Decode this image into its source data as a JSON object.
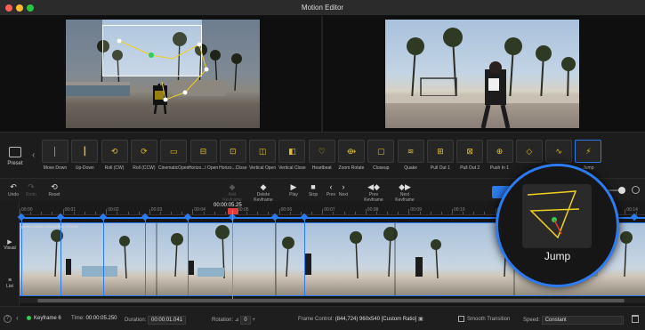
{
  "window": {
    "title": "Motion Editor"
  },
  "preset": {
    "tab_label": "Preset",
    "items": [
      {
        "name": "Move Down",
        "icon": "move-down-icon"
      },
      {
        "name": "Up-Down",
        "icon": "up-down-icon"
      },
      {
        "name": "Roll (CW)",
        "icon": "roll-cw-icon"
      },
      {
        "name": "Roll (CCW)",
        "icon": "roll-ccw-icon"
      },
      {
        "name": "CinematicOpen",
        "icon": "cinematic-open-icon"
      },
      {
        "name": "Horizo...l Open",
        "icon": "horizontal-open-icon"
      },
      {
        "name": "Horizo...Close",
        "icon": "horizontal-close-icon"
      },
      {
        "name": "Vertical Open",
        "icon": "vertical-open-icon"
      },
      {
        "name": "Vertical Close",
        "icon": "vertical-close-icon"
      },
      {
        "name": "Heartbeat",
        "icon": "heartbeat-icon"
      },
      {
        "name": "Zoom Rotate",
        "icon": "zoom-rotate-icon"
      },
      {
        "name": "Closeup",
        "icon": "closeup-icon"
      },
      {
        "name": "Quake",
        "icon": "quake-icon"
      },
      {
        "name": "Pull Out 1",
        "icon": "pull-out-1-icon"
      },
      {
        "name": "Pull Out 2",
        "icon": "pull-out-2-icon"
      },
      {
        "name": "Push In 1",
        "icon": "push-in-1-icon"
      },
      {
        "name": "",
        "icon": "preset-icon"
      },
      {
        "name": "Earthquake",
        "icon": "earthquake-icon"
      },
      {
        "name": "Jump",
        "icon": "jump-icon"
      }
    ],
    "selected": "Jump"
  },
  "toolbar": {
    "undo": "Undo",
    "redo": "Redo",
    "reset": "Reset",
    "add_keyframe": "Add Keyframe",
    "delete_keyframe": "Delete Keyframe",
    "play": "Play",
    "stop": "Stop",
    "prev": "Prev",
    "next": "Next",
    "prev_keyframe": "Prev Keyframe",
    "next_keyframe": "Next Keyframe"
  },
  "timeline": {
    "playhead_time": "00:00:05.25",
    "ruler_labels": [
      "00:00",
      "00:01",
      "00:02",
      "00:03",
      "00:04",
      "00:05",
      "00:06",
      "00:07",
      "00:08",
      "00:09",
      "00:10",
      "00:11",
      "00:12",
      "00:13",
      "00:14"
    ],
    "track_name": "pexels-rodnae-productions-7224781",
    "side_visual": "Visual",
    "side_list": "List",
    "keyframe_count": 9
  },
  "magnifier": {
    "label": "Jump"
  },
  "statusbar": {
    "keyframe_label": "Keyframe 6",
    "time_label": "Time:",
    "time_value": "00:00:05.250",
    "duration_label": "Duration:",
    "duration_value": "00:00:01.041",
    "rotation_label": "Rotation:",
    "rotation_value": "0",
    "frame_control_label": "Frame Control:",
    "frame_control_value": "(844,724)  960x540  [Custom Ratio]",
    "smooth_label": "Smooth Transition",
    "speed_label": "Speed:",
    "speed_value": "Constant"
  },
  "colors": {
    "accent": "#2d7bf0",
    "playhead": "#33cc55",
    "keyframe_flag": "#e23b3b",
    "jump_path": "#f0d020"
  }
}
